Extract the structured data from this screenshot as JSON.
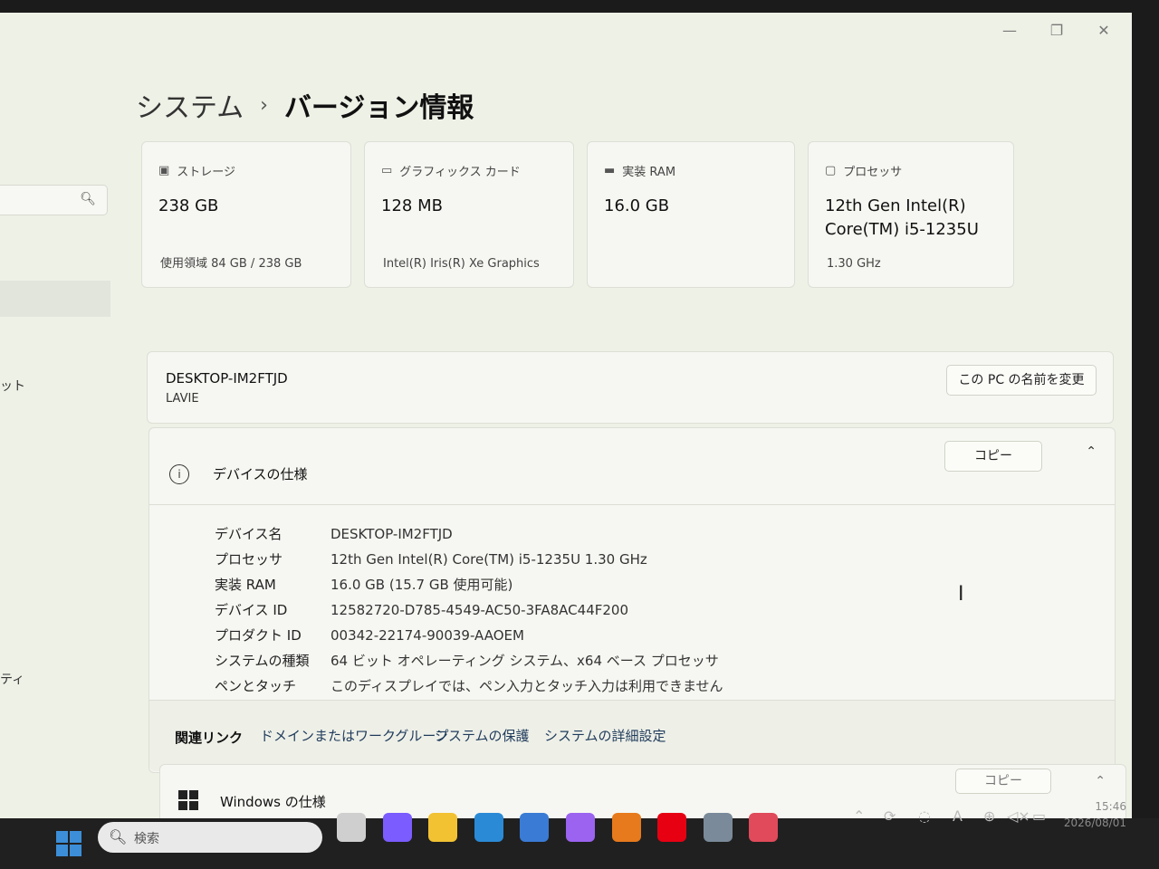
{
  "window": {
    "controls": [
      "—",
      "❐",
      "✕"
    ]
  },
  "sidebar": {
    "search_icon": "search-icon",
    "item_upper": "ット",
    "item_lower": "ティ"
  },
  "breadcrumb": {
    "parent": "システム",
    "separator": "›",
    "title": "バージョン情報"
  },
  "cards": [
    {
      "label": "ストレージ",
      "value": "238 GB",
      "sub": "使用領域 84 GB / 238 GB",
      "icon": "storage-icon"
    },
    {
      "label": "グラフィックス カード",
      "value": "128 MB",
      "sub": "Intel(R) Iris(R) Xe Graphics",
      "icon": "graphics-card-icon"
    },
    {
      "label": "実装 RAM",
      "value": "16.0 GB",
      "sub": "",
      "icon": "ram-icon"
    },
    {
      "label": "プロセッサ",
      "value_line1": "12th Gen Intel(R)",
      "value_line2": "Core(TM) i5-1235U",
      "sub": "1.30 GHz",
      "icon": "processor-icon"
    }
  ],
  "device": {
    "name": "DESKTOP-IM2FTJD",
    "model": "LAVIE",
    "rename_button": "この PC の名前を変更"
  },
  "specs": {
    "title": "デバイスの仕様",
    "copy_button": "コピー",
    "rows": [
      {
        "k": "デバイス名",
        "v": "DESKTOP-IM2FTJD"
      },
      {
        "k": "プロセッサ",
        "v": "12th Gen Intel(R) Core(TM) i5-1235U   1.30 GHz"
      },
      {
        "k": "実装 RAM",
        "v": "16.0 GB (15.7 GB 使用可能)"
      },
      {
        "k": "デバイス ID",
        "v": "12582720-D785-4549-AC50-3FA8AC44F200"
      },
      {
        "k": "プロダクト ID",
        "v": "00342-22174-90039-AAOEM"
      },
      {
        "k": "システムの種類",
        "v": "64 ビット オペレーティング システム、x64 ベース プロセッサ"
      },
      {
        "k": "ペンとタッチ",
        "v": "このディスプレイでは、ペン入力とタッチ入力は利用できません"
      }
    ]
  },
  "related": {
    "label": "関連リンク",
    "links": [
      "ドメインまたはワークグループ",
      "システムの保護",
      "システムの詳細設定"
    ]
  },
  "windows_spec": {
    "title": "Windows の仕様",
    "copy_button": "コピー"
  },
  "taskbar": {
    "search_placeholder": "検索",
    "time": "15:46",
    "date": "2026/08/01",
    "ime": "A",
    "apps": [
      {
        "name": "task-view",
        "color": "#cfcfcf"
      },
      {
        "name": "copilot",
        "color": "#7a5cff"
      },
      {
        "name": "file-explorer",
        "color": "#f2c233"
      },
      {
        "name": "edge",
        "color": "#2b8ad6"
      },
      {
        "name": "store",
        "color": "#3a7bd5"
      },
      {
        "name": "app-purple",
        "color": "#9b63f0"
      },
      {
        "name": "app-orange",
        "color": "#e77a1c"
      },
      {
        "name": "yahoo",
        "color": "#e60012"
      },
      {
        "name": "settings",
        "color": "#7a8a9a"
      },
      {
        "name": "app-red",
        "color": "#e04a5a"
      }
    ]
  }
}
